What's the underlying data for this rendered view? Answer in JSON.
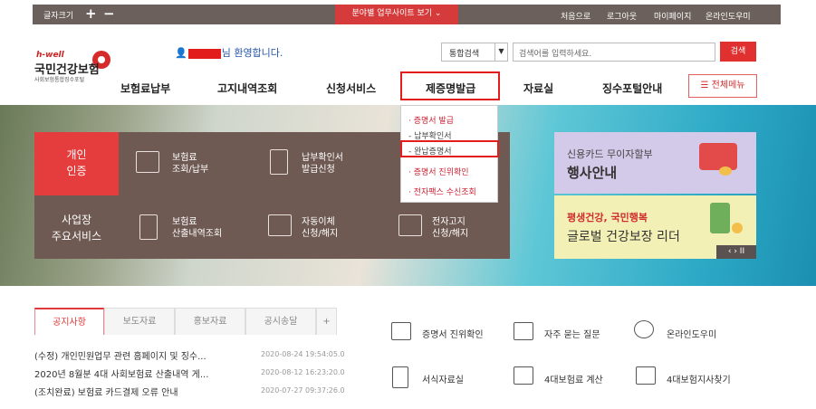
{
  "topbar": {
    "font_size_label": "글자크기",
    "plus": "+",
    "minus": "−",
    "site_select": "분야별 업무사이트 보기 ⌄",
    "utils": [
      "처음으로",
      "로그아웃",
      "마이페이지",
      "온라인도우미"
    ]
  },
  "logo": {
    "tagline": "h-well",
    "name": "국민건강보험",
    "sub": "사회보험통합징수포털"
  },
  "welcome": {
    "suffix": "님 환영합니다."
  },
  "search": {
    "scope": "통합검색",
    "placeholder": "검색어를 입력하세요.",
    "button": "검색"
  },
  "nav": {
    "items": [
      "보험료납부",
      "고지내역조회",
      "신청서비스",
      "제증명발급",
      "자료실",
      "징수포털안내"
    ],
    "all_menu": "전체메뉴"
  },
  "dropdown": {
    "items": [
      "· 증명서 발급",
      "- 납부확인서",
      "- 완납증명서",
      "· 증명서 진위확인",
      "· 전자팩스 수신조회"
    ]
  },
  "quick": {
    "personal": [
      "개인",
      "인증"
    ],
    "business": [
      "사업장",
      "주요서비스"
    ],
    "services": [
      [
        "보험료",
        "조회/납부"
      ],
      [
        "납부확인서",
        "발급신청"
      ],
      [
        "보험료",
        "산출내역조회"
      ],
      [
        "자동이체",
        "신청/해지"
      ],
      [
        "전자고지",
        "신청/해지"
      ]
    ]
  },
  "promos": [
    {
      "line1": "신용카드 무이자할부",
      "line2": "행사안내"
    },
    {
      "line1": "평생건강, 국민행복",
      "line2": "글로벌 건강보장 리더"
    }
  ],
  "slider": {
    "controls": "‹  ›  II"
  },
  "notice": {
    "tabs": [
      "공지사항",
      "보도자료",
      "홍보자료",
      "공시송달",
      "+"
    ],
    "items": [
      {
        "title": "(수정) 개인민원업무 관련 홈페이지 및 징수...",
        "date": "2020-08-24 19:54:05.0"
      },
      {
        "title": "2020년 8월분 4대 사회보험료 산출내역 게...",
        "date": "2020-08-12 16:23:20.0"
      },
      {
        "title": "(조치완료) 보험료 카드결제 오류 안내",
        "date": "2020-07-27 09:37:26.0"
      }
    ]
  },
  "quicklinks": [
    "증명서 진위확인",
    "자주 묻는 질문",
    "온라인도우미",
    "서식자료실",
    "4대보험료 계산",
    "4대보험지사찾기"
  ],
  "colors": {
    "accent": "#e03030",
    "brown": "#6e5a52"
  }
}
